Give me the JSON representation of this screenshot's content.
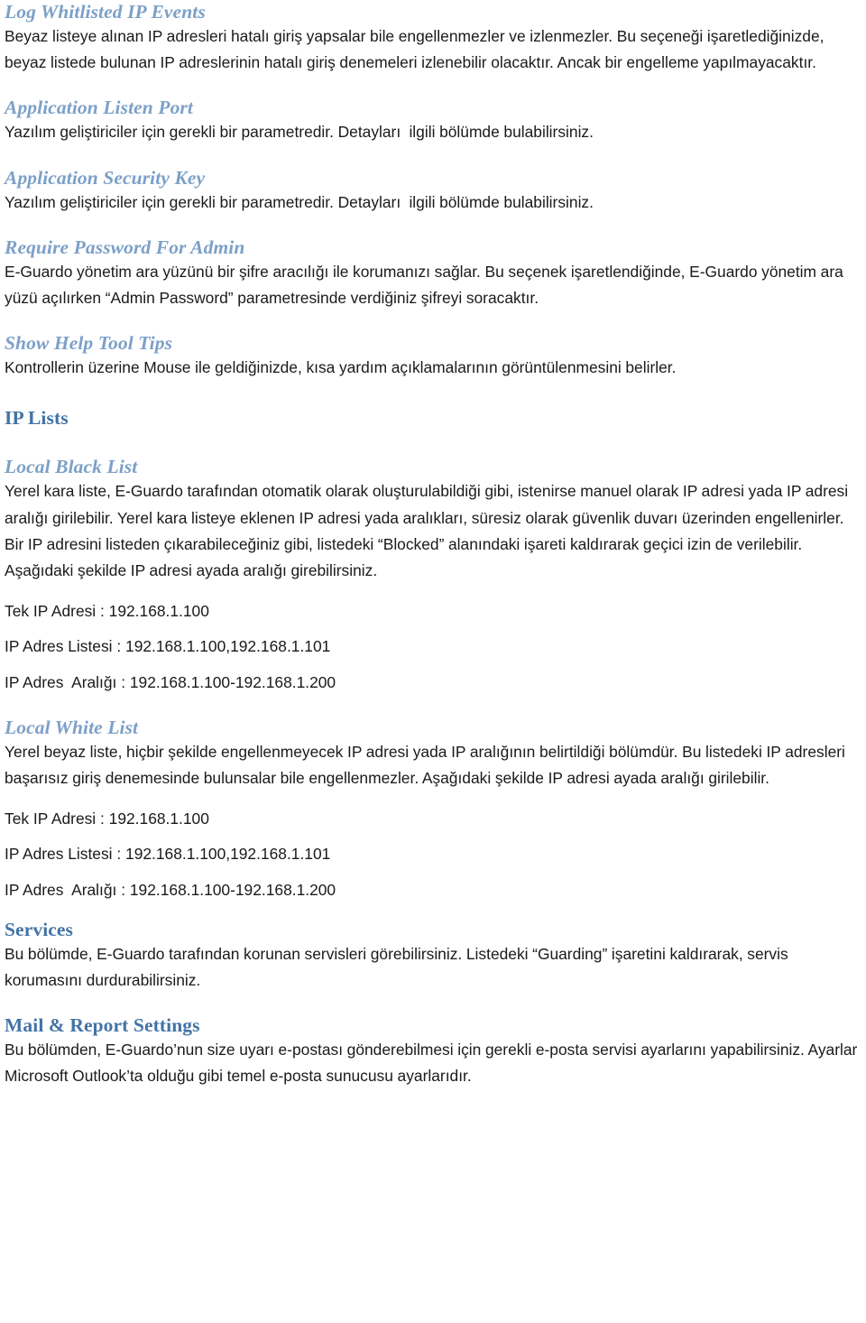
{
  "document": {
    "language": "tr",
    "heading_color_level1": "#4273A5",
    "heading_color_level2": "#7CA0C8",
    "body_color": "#1a1a1a"
  },
  "sections": [
    {
      "id": "log-whitlisted-ip-events",
      "level": 2,
      "heading": "Log Whitlisted IP Events",
      "paragraph": "Beyaz listeye alınan IP adresleri hatalı giriş yapsalar bile engellenmezler ve izlenmezler. Bu seçeneği işaretlediğinizde, beyaz listede bulunan IP adreslerinin hatalı giriş denemeleri izlenebilir olacaktır. Ancak bir engelleme yapılmayacaktır."
    },
    {
      "id": "application-listen-port",
      "level": 2,
      "heading": "Application Listen Port",
      "paragraph": "Yazılım geliştiriciler için gerekli bir parametredir. Detayları  ilgili bölümde bulabilirsiniz."
    },
    {
      "id": "application-security-key",
      "level": 2,
      "heading": "Application Security Key",
      "paragraph": "Yazılım geliştiriciler için gerekli bir parametredir. Detayları  ilgili bölümde bulabilirsiniz."
    },
    {
      "id": "require-password-for-admin",
      "level": 2,
      "heading": "Require Password For Admin",
      "paragraph": "E-Guardo yönetim ara yüzünü bir şifre aracılığı ile korumanızı sağlar. Bu seçenek işaretlendiğinde, E-Guardo yönetim ara yüzü açılırken “Admin Password” parametresinde verdiğiniz şifreyi soracaktır."
    },
    {
      "id": "show-help-tool-tips",
      "level": 2,
      "heading": "Show Help Tool Tips",
      "paragraph": "Kontrollerin üzerine Mouse ile geldiğinizde, kısa yardım açıklamalarının görüntülenmesini belirler."
    },
    {
      "id": "ip-lists",
      "level": 1,
      "heading": "IP Lists",
      "paragraph": ""
    },
    {
      "id": "local-black-list",
      "level": 2,
      "heading": "Local Black List",
      "paragraph": "Yerel kara liste, E-Guardo tarafından otomatik olarak oluşturulabildiği gibi, istenirse manuel olarak IP adresi yada IP adresi aralığı girilebilir. Yerel kara listeye eklenen IP adresi yada aralıkları, süresiz olarak güvenlik duvarı üzerinden engellenirler. Bir IP adresini listeden çıkarabileceğiniz gibi, listedeki “Blocked” alanındaki işareti kaldırarak geçici izin de verilebilir. Aşağıdaki şekilde IP adresi ayada aralığı girebilirsiniz.",
      "examples": [
        "Tek IP Adresi : 192.168.1.100",
        "IP Adres Listesi : 192.168.1.100,192.168.1.101",
        "IP Adres  Aralığı : 192.168.1.100-192.168.1.200"
      ]
    },
    {
      "id": "local-white-list",
      "level": 2,
      "heading": "Local White List",
      "paragraph": "Yerel beyaz liste, hiçbir şekilde engellenmeyecek IP adresi yada IP aralığının belirtildiği bölümdür. Bu listedeki IP adresleri başarısız giriş denemesinde bulunsalar bile engellenmezler. Aşağıdaki şekilde IP adresi ayada aralığı girilebilir.",
      "examples": [
        "Tek IP Adresi : 192.168.1.100",
        "IP Adres Listesi : 192.168.1.100,192.168.1.101",
        "IP Adres  Aralığı : 192.168.1.100-192.168.1.200"
      ]
    },
    {
      "id": "services",
      "level": 1,
      "heading": "Services",
      "paragraph": "Bu bölümde, E-Guardo tarafından korunan servisleri görebilirsiniz. Listedeki “Guarding” işaretini kaldırarak, servis korumasını durdurabilirsiniz."
    },
    {
      "id": "mail-report-settings",
      "level": 1,
      "heading": "Mail & Report Settings",
      "paragraph": "Bu bölümden, E-Guardo’nun size uyarı e-postası gönderebilmesi için gerekli e-posta servisi ayarlarını yapabilirsiniz. Ayarlar Microsoft Outlook’ta olduğu gibi temel e-posta sunucusu ayarlarıdır."
    }
  ]
}
